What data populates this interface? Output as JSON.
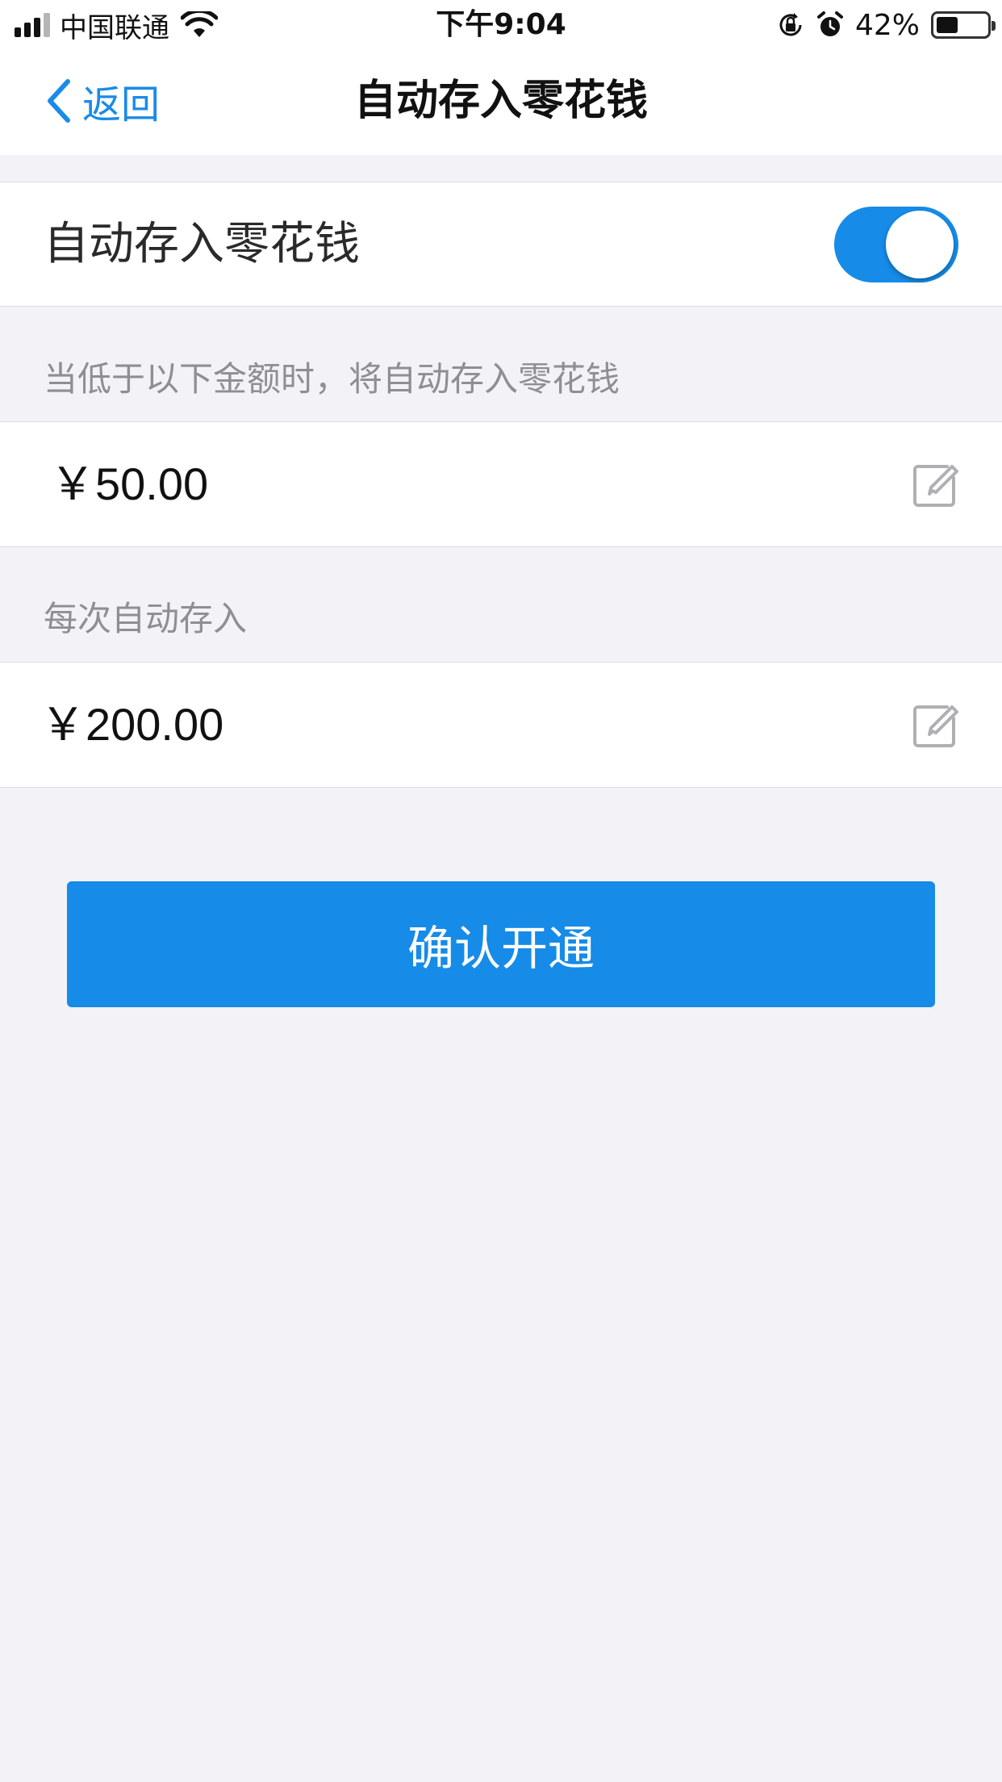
{
  "status_bar": {
    "carrier": "中国联通",
    "time": "下午9:04",
    "battery_percent": "42%",
    "battery_level": 0.42,
    "icons": [
      "signal-icon",
      "wifi-icon",
      "orientation-lock-icon",
      "alarm-icon",
      "battery-icon"
    ]
  },
  "nav": {
    "back_label": "返回",
    "title": "自动存入零花钱"
  },
  "auto_save": {
    "label": "自动存入零花钱",
    "enabled": true
  },
  "threshold": {
    "label": "当低于以下金额时，将自动存入零花钱",
    "value": "￥50.00"
  },
  "deposit": {
    "label": "每次自动存入",
    "value": "￥200.00"
  },
  "confirm_button": "确认开通",
  "colors": {
    "accent": "#1a8be8",
    "button": "#168be8",
    "background": "#f2f2f7",
    "switch_on": "#168be8",
    "icon_gray": "#b0b0b4"
  }
}
